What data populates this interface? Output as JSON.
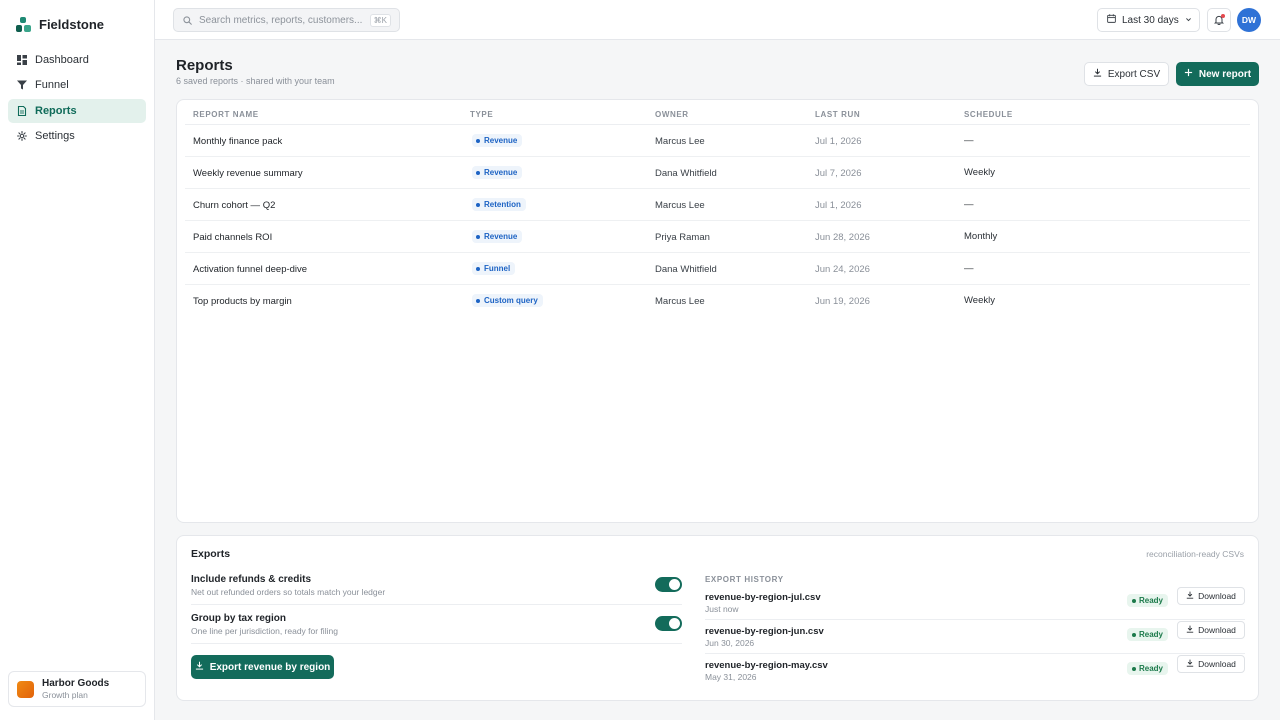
{
  "app": {
    "brand": "Fieldstone"
  },
  "sidebar": {
    "items": [
      {
        "label": "Dashboard",
        "icon": "dashboard-icon"
      },
      {
        "label": "Funnel",
        "icon": "funnel-icon"
      },
      {
        "label": "Reports",
        "icon": "document-icon",
        "active": true
      },
      {
        "label": "Settings",
        "icon": "gear-icon"
      }
    ],
    "workspace": {
      "name": "Harbor Goods",
      "plan": "Growth plan"
    }
  },
  "topbar": {
    "search_placeholder": "Search metrics, reports, customers...",
    "search_shortcut": "⌘K",
    "date_range": "Last 30 days",
    "avatar_initials": "DW"
  },
  "page": {
    "title": "Reports",
    "subtitle": "6 saved reports · shared with your team",
    "export_csv_label": "Export CSV",
    "new_report_label": "New report"
  },
  "table": {
    "headers": [
      "REPORT NAME",
      "TYPE",
      "OWNER",
      "LAST RUN",
      "SCHEDULE"
    ],
    "rows": [
      {
        "name": "Monthly finance pack",
        "type": "Revenue",
        "owner": "Marcus Lee",
        "last_run": "Jul 1, 2026",
        "schedule": "—"
      },
      {
        "name": "Weekly revenue summary",
        "type": "Revenue",
        "owner": "Dana Whitfield",
        "last_run": "Jul 7, 2026",
        "schedule": "Weekly"
      },
      {
        "name": "Churn cohort — Q2",
        "type": "Retention",
        "owner": "Marcus Lee",
        "last_run": "Jul 1, 2026",
        "schedule": "—"
      },
      {
        "name": "Paid channels ROI",
        "type": "Revenue",
        "owner": "Priya Raman",
        "last_run": "Jun 28, 2026",
        "schedule": "Monthly"
      },
      {
        "name": "Activation funnel deep-dive",
        "type": "Funnel",
        "owner": "Dana Whitfield",
        "last_run": "Jun 24, 2026",
        "schedule": "—"
      },
      {
        "name": "Top products by margin",
        "type": "Custom query",
        "owner": "Marcus Lee",
        "last_run": "Jun 19, 2026",
        "schedule": "Weekly"
      }
    ]
  },
  "exports": {
    "title": "Exports",
    "note": "reconciliation-ready CSVs",
    "options": [
      {
        "title": "Include refunds & credits",
        "desc": "Net out refunded orders so totals match your ledger",
        "enabled": true
      },
      {
        "title": "Group by tax region",
        "desc": "One line per jurisdiction, ready for filing",
        "enabled": true
      }
    ],
    "export_button": "Export revenue by region",
    "history_header": "EXPORT HISTORY",
    "history": [
      {
        "file": "revenue-by-region-jul.csv",
        "date": "Just now",
        "status": "Ready",
        "action": "Download"
      },
      {
        "file": "revenue-by-region-jun.csv",
        "date": "Jun 30, 2026",
        "status": "Ready",
        "action": "Download"
      },
      {
        "file": "revenue-by-region-may.csv",
        "date": "May 31, 2026",
        "status": "Ready",
        "action": "Download"
      }
    ]
  },
  "colors": {
    "accent": "#136b5b",
    "tag_blue": "#1d63c4",
    "ready_green": "#1c7a4b",
    "avatar": "#2f72d6"
  }
}
